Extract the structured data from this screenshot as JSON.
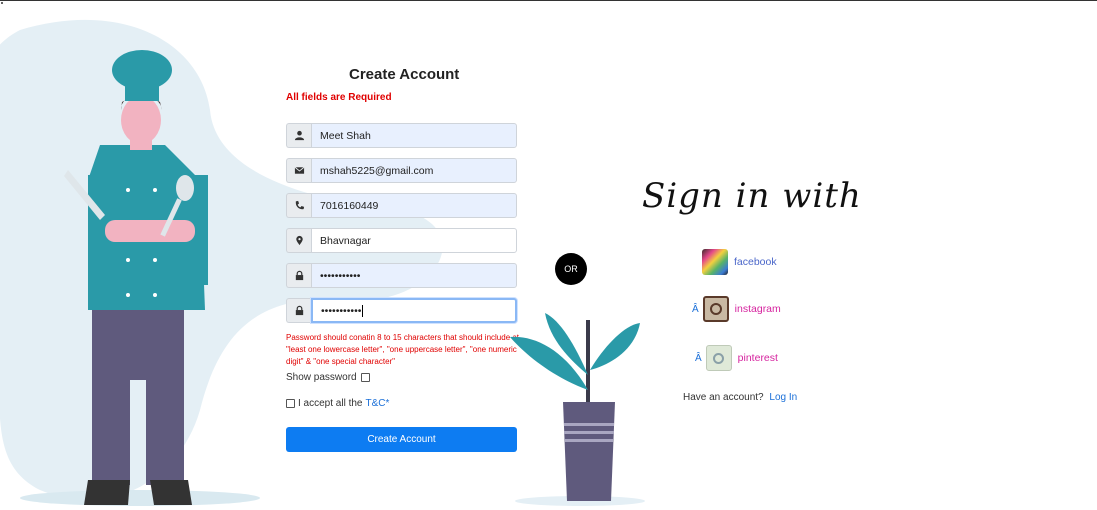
{
  "form": {
    "title": "Create Account",
    "required_msg": "All fields are Required",
    "fields": [
      {
        "icon": "user-icon",
        "value": "Meet Shah"
      },
      {
        "icon": "envelope-icon",
        "value": "mshah5225@gmail.com"
      },
      {
        "icon": "phone-icon",
        "value": "7016160449"
      },
      {
        "icon": "map-marker-icon",
        "value": "Bhavnagar"
      },
      {
        "icon": "lock-icon",
        "value": "•••••••••••"
      },
      {
        "icon": "lock-icon",
        "value": "•••••••••••"
      }
    ],
    "password_error": "Password should conatin 8 to 15 characters that should include at \"least one lowercase letter\", \"one uppercase letter\", \"one numeric digit\" & \"one special character\"",
    "show_password_label": "Show password",
    "accept_label": "I accept all the",
    "accept_link": "T&C*",
    "submit_label": "Create Account"
  },
  "or_label": "OR",
  "signin": {
    "heading": "Sign in with",
    "socials": [
      {
        "prefix": "",
        "label": "facebook"
      },
      {
        "prefix": "Â",
        "label": "instagram"
      },
      {
        "prefix": "Â",
        "label": "pinterest"
      }
    ],
    "have_account": "Have an account?",
    "login_link": "Log In"
  },
  "colors": {
    "primary": "#0d7cf2",
    "error": "#e00000",
    "chef_teal": "#2a9aa8",
    "pants": "#5f5a7d",
    "blob": "#e4eff5"
  }
}
